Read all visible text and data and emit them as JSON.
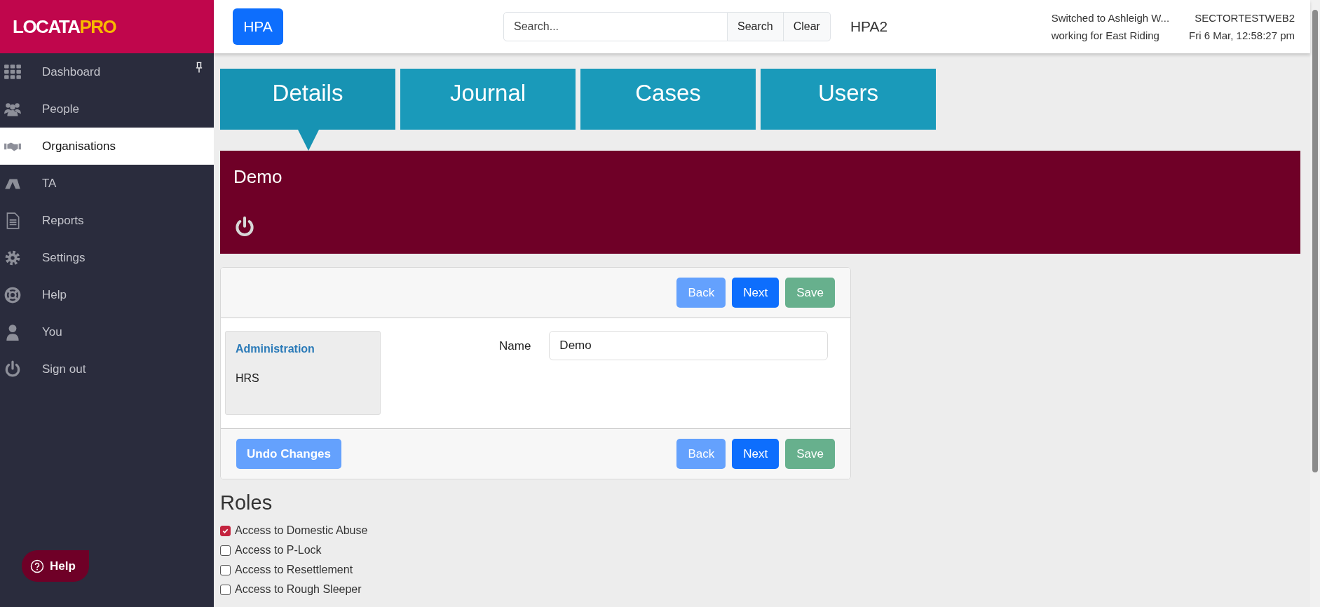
{
  "logo": {
    "main": "LOCATA",
    "accent": "PRO"
  },
  "sidebar": {
    "items": [
      {
        "label": "Dashboard",
        "selected": false
      },
      {
        "label": "People",
        "selected": false
      },
      {
        "label": "Organisations",
        "selected": true
      },
      {
        "label": "TA",
        "selected": false
      },
      {
        "label": "Reports",
        "selected": false
      },
      {
        "label": "Settings",
        "selected": false
      },
      {
        "label": "Help",
        "selected": false
      },
      {
        "label": "You",
        "selected": false
      },
      {
        "label": "Sign out",
        "selected": false
      }
    ],
    "help_button": "Help"
  },
  "header": {
    "app_button": "HPA",
    "search": {
      "placeholder": "Search...",
      "search_button": "Search",
      "clear_button": "Clear"
    },
    "context": "HPA2",
    "user_lines": [
      "Switched to Ashleigh W...",
      "working for East Riding"
    ],
    "server": "SECTORTESTWEB2",
    "datetime": "Fri 6 Mar, 12:58:27 pm"
  },
  "tabs": [
    {
      "label": "Details",
      "selected": true
    },
    {
      "label": "Journal",
      "selected": false
    },
    {
      "label": "Cases",
      "selected": false
    },
    {
      "label": "Users",
      "selected": false
    }
  ],
  "banner": {
    "title": "Demo"
  },
  "form": {
    "top_buttons": [
      "Back",
      "Next",
      "Save"
    ],
    "side_panel": {
      "heading": "Administration",
      "value": "HRS"
    },
    "name_label": "Name",
    "name_value": "Demo",
    "undo_button": "Undo Changes",
    "bottom_buttons": [
      "Back",
      "Next",
      "Save"
    ]
  },
  "roles": {
    "heading": "Roles",
    "items": [
      {
        "label": "Access to Domestic Abuse",
        "checked": true
      },
      {
        "label": "Access to P-Lock",
        "checked": false
      },
      {
        "label": "Access to Resettlement",
        "checked": false
      },
      {
        "label": "Access to Rough Sleeper",
        "checked": false
      }
    ]
  }
}
